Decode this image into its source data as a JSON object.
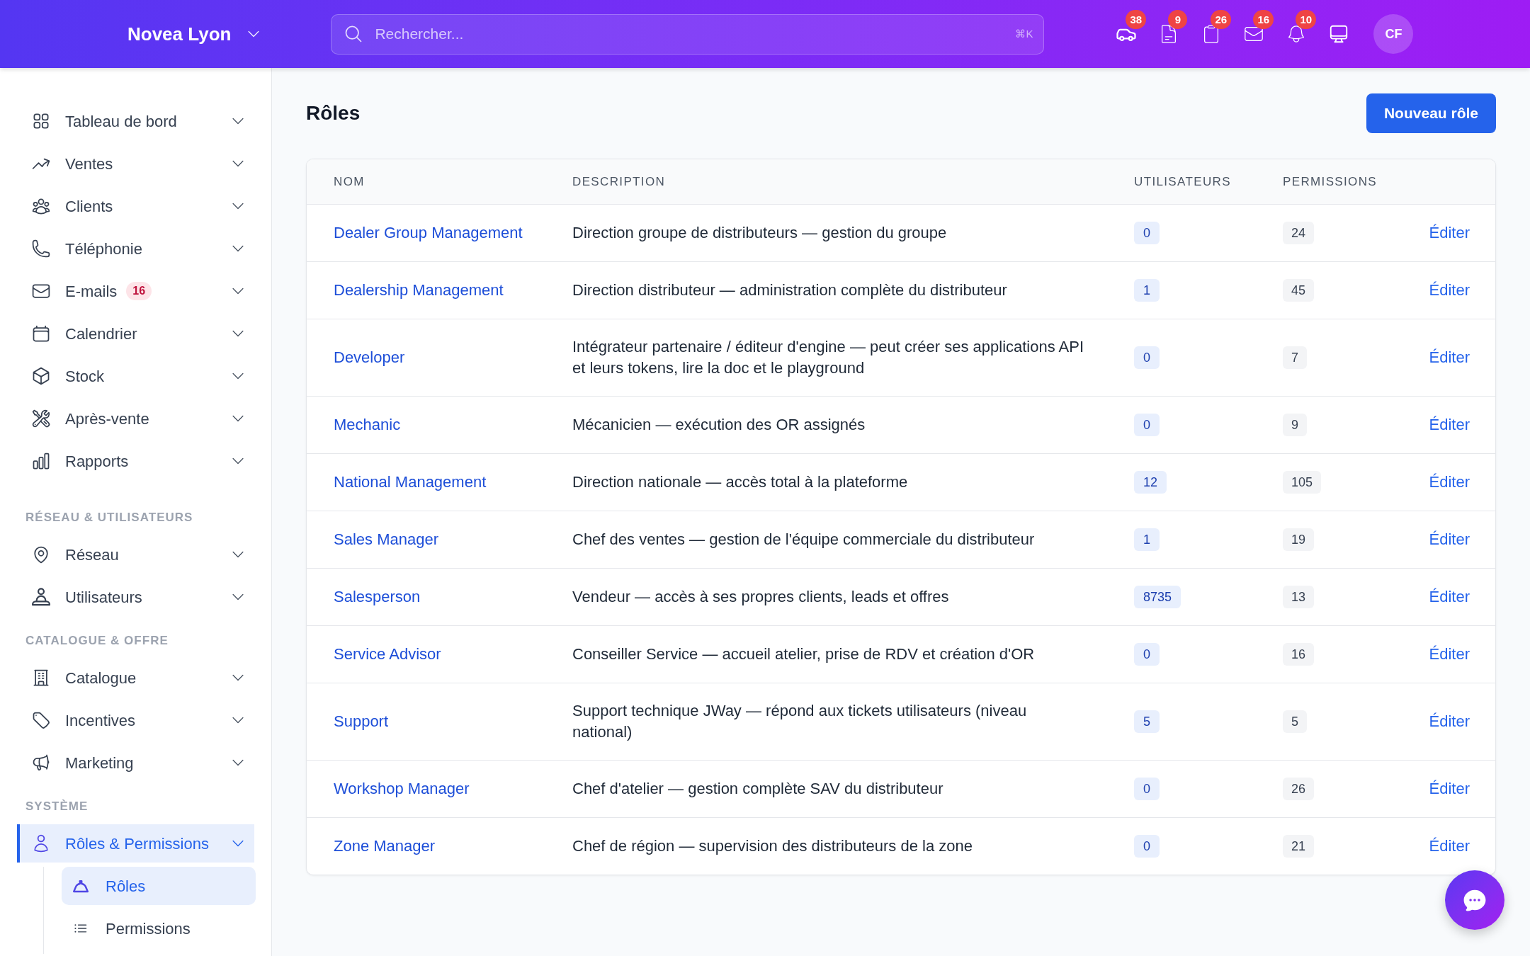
{
  "header": {
    "org": "Novea Lyon",
    "search": {
      "placeholder": "Rechercher...",
      "shortcut": "⌘K"
    },
    "toolbar": [
      {
        "badge": "38"
      },
      {
        "badge": "9"
      },
      {
        "badge": "26"
      },
      {
        "badge": "16"
      },
      {
        "badge": "10"
      }
    ],
    "avatar": "CF"
  },
  "sidebar": {
    "sections": [
      {
        "items": [
          {
            "label": "Tableau de bord",
            "selected": false
          },
          {
            "label": "Ventes",
            "selected": false
          },
          {
            "label": "Clients",
            "selected": false
          },
          {
            "label": "Téléphonie",
            "selected": false
          },
          {
            "label": "E-mails",
            "badge": "16",
            "selected": false
          },
          {
            "label": "Calendrier",
            "selected": false
          },
          {
            "label": "Stock",
            "selected": false
          },
          {
            "label": "Après-vente",
            "selected": false
          },
          {
            "label": "Rapports",
            "selected": false
          }
        ]
      },
      {
        "heading": "RÉSEAU & UTILISATEURS",
        "items": [
          {
            "label": "Réseau",
            "selected": false
          },
          {
            "label": "Utilisateurs",
            "selected": false
          }
        ]
      },
      {
        "heading": "CATALOGUE & OFFRE",
        "items": [
          {
            "label": "Catalogue",
            "selected": false
          },
          {
            "label": "Incentives",
            "selected": false
          },
          {
            "label": "Marketing",
            "selected": false
          }
        ]
      },
      {
        "heading": "SYSTÈME",
        "items": [
          {
            "label": "Rôles & Permissions",
            "selected": true,
            "expanded": true,
            "children": [
              {
                "label": "Rôles",
                "selected": true
              },
              {
                "label": "Permissions",
                "selected": false
              }
            ]
          }
        ]
      }
    ]
  },
  "page": {
    "title": "Rôles",
    "new_button": "Nouveau rôle"
  },
  "table": {
    "columns": [
      "NOM",
      "DESCRIPTION",
      "UTILISATEURS",
      "PERMISSIONS"
    ],
    "rows": [
      {
        "name": "Dealer Group Management",
        "description": "Direction groupe de distributeurs — gestion du groupe",
        "users": "0",
        "permissions": "24",
        "action": "Éditer"
      },
      {
        "name": "Dealership Management",
        "description": "Direction distributeur — administration complète du distributeur",
        "users": "1",
        "permissions": "45",
        "action": "Éditer"
      },
      {
        "name": "Developer",
        "description": "Intégrateur partenaire / éditeur d'engine — peut créer ses applications API et leurs tokens, lire la doc et le playground",
        "users": "0",
        "permissions": "7",
        "action": "Éditer"
      },
      {
        "name": "Mechanic",
        "description": "Mécanicien — exécution des OR assignés",
        "users": "0",
        "permissions": "9",
        "action": "Éditer"
      },
      {
        "name": "National Management",
        "description": "Direction nationale — accès total à la plateforme",
        "users": "12",
        "permissions": "105",
        "action": "Éditer"
      },
      {
        "name": "Sales Manager",
        "description": "Chef des ventes — gestion de l'équipe commerciale du distributeur",
        "users": "1",
        "permissions": "19",
        "action": "Éditer"
      },
      {
        "name": "Salesperson",
        "description": "Vendeur — accès à ses propres clients, leads et offres",
        "users": "8735",
        "permissions": "13",
        "action": "Éditer"
      },
      {
        "name": "Service Advisor",
        "description": "Conseiller Service — accueil atelier, prise de RDV et création d'OR",
        "users": "0",
        "permissions": "16",
        "action": "Éditer"
      },
      {
        "name": "Support",
        "description": "Support technique JWay — répond aux tickets utilisateurs (niveau national)",
        "users": "5",
        "permissions": "5",
        "action": "Éditer"
      },
      {
        "name": "Workshop Manager",
        "description": "Chef d'atelier — gestion complète SAV du distributeur",
        "users": "0",
        "permissions": "26",
        "action": "Éditer"
      },
      {
        "name": "Zone Manager",
        "description": "Chef de région — supervision des distributeurs de la zone",
        "users": "0",
        "permissions": "21",
        "action": "Éditer"
      }
    ]
  }
}
